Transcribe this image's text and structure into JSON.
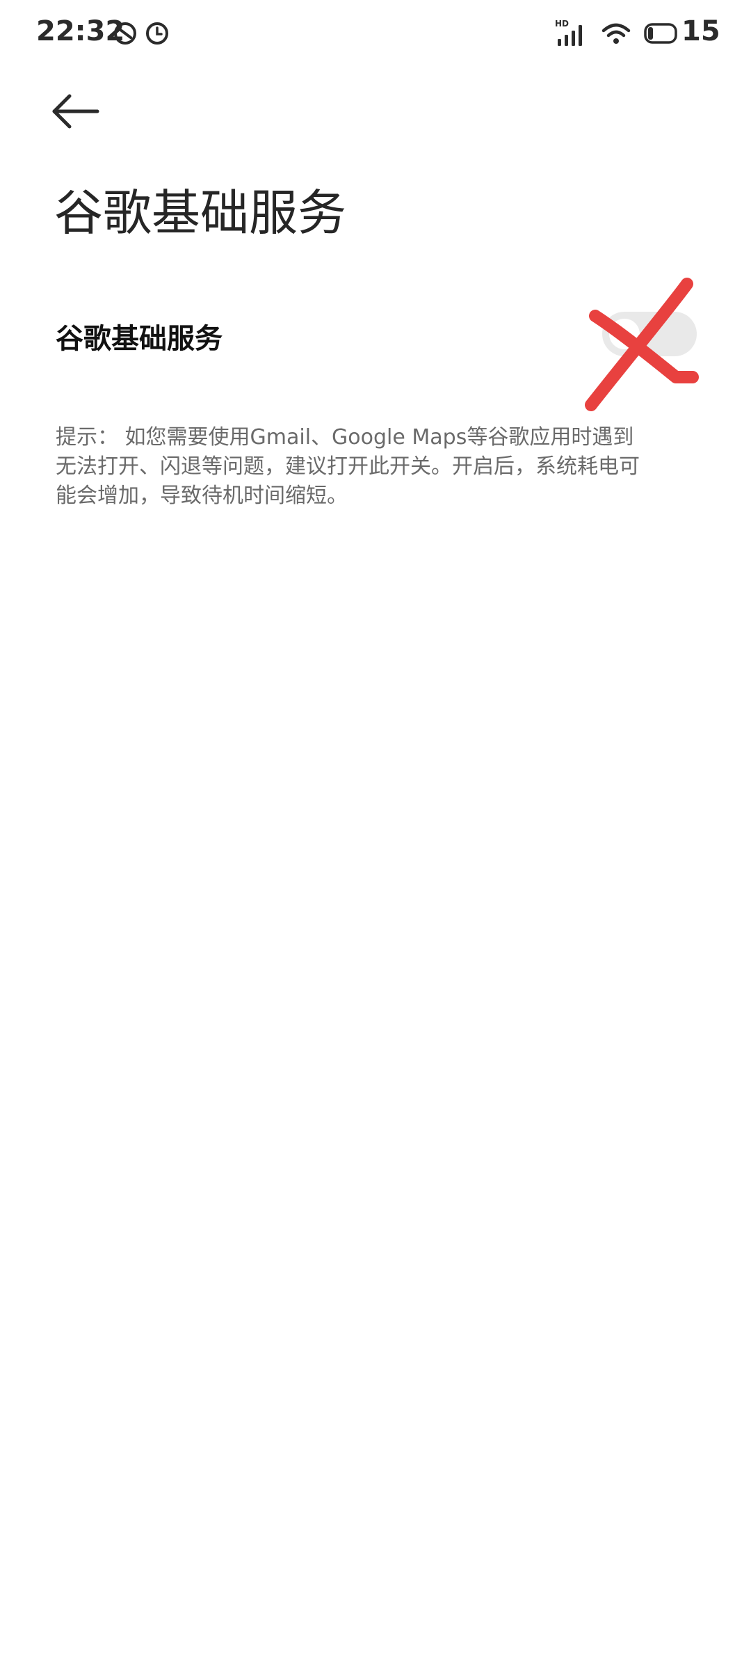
{
  "status_bar": {
    "time": "22:32",
    "network_label": "HD",
    "battery_level": "15",
    "icons": [
      "do-not-disturb-icon",
      "alarm-icon",
      "signal-icon",
      "wifi-icon",
      "battery-icon"
    ]
  },
  "header": {
    "back_icon": "arrow-left-icon",
    "title": "谷歌基础服务"
  },
  "setting": {
    "label": "谷歌基础服务",
    "toggle_state": "off",
    "annotation": "red-cross-mark"
  },
  "hint": {
    "lines": [
      "提示： 如您需要使用Gmail、Google Maps等谷歌应用时遇到",
      "无法打开、闪退等问题，建议打开此开关。开启后，系统耗电可",
      "能会增加，导致待机时间缩短。"
    ]
  },
  "colors": {
    "background": "#ffffff",
    "title": "#262626",
    "hint": "#6a6a6a",
    "toggle_track": "#e9e9e9",
    "annotation_red": "#e8413f"
  }
}
